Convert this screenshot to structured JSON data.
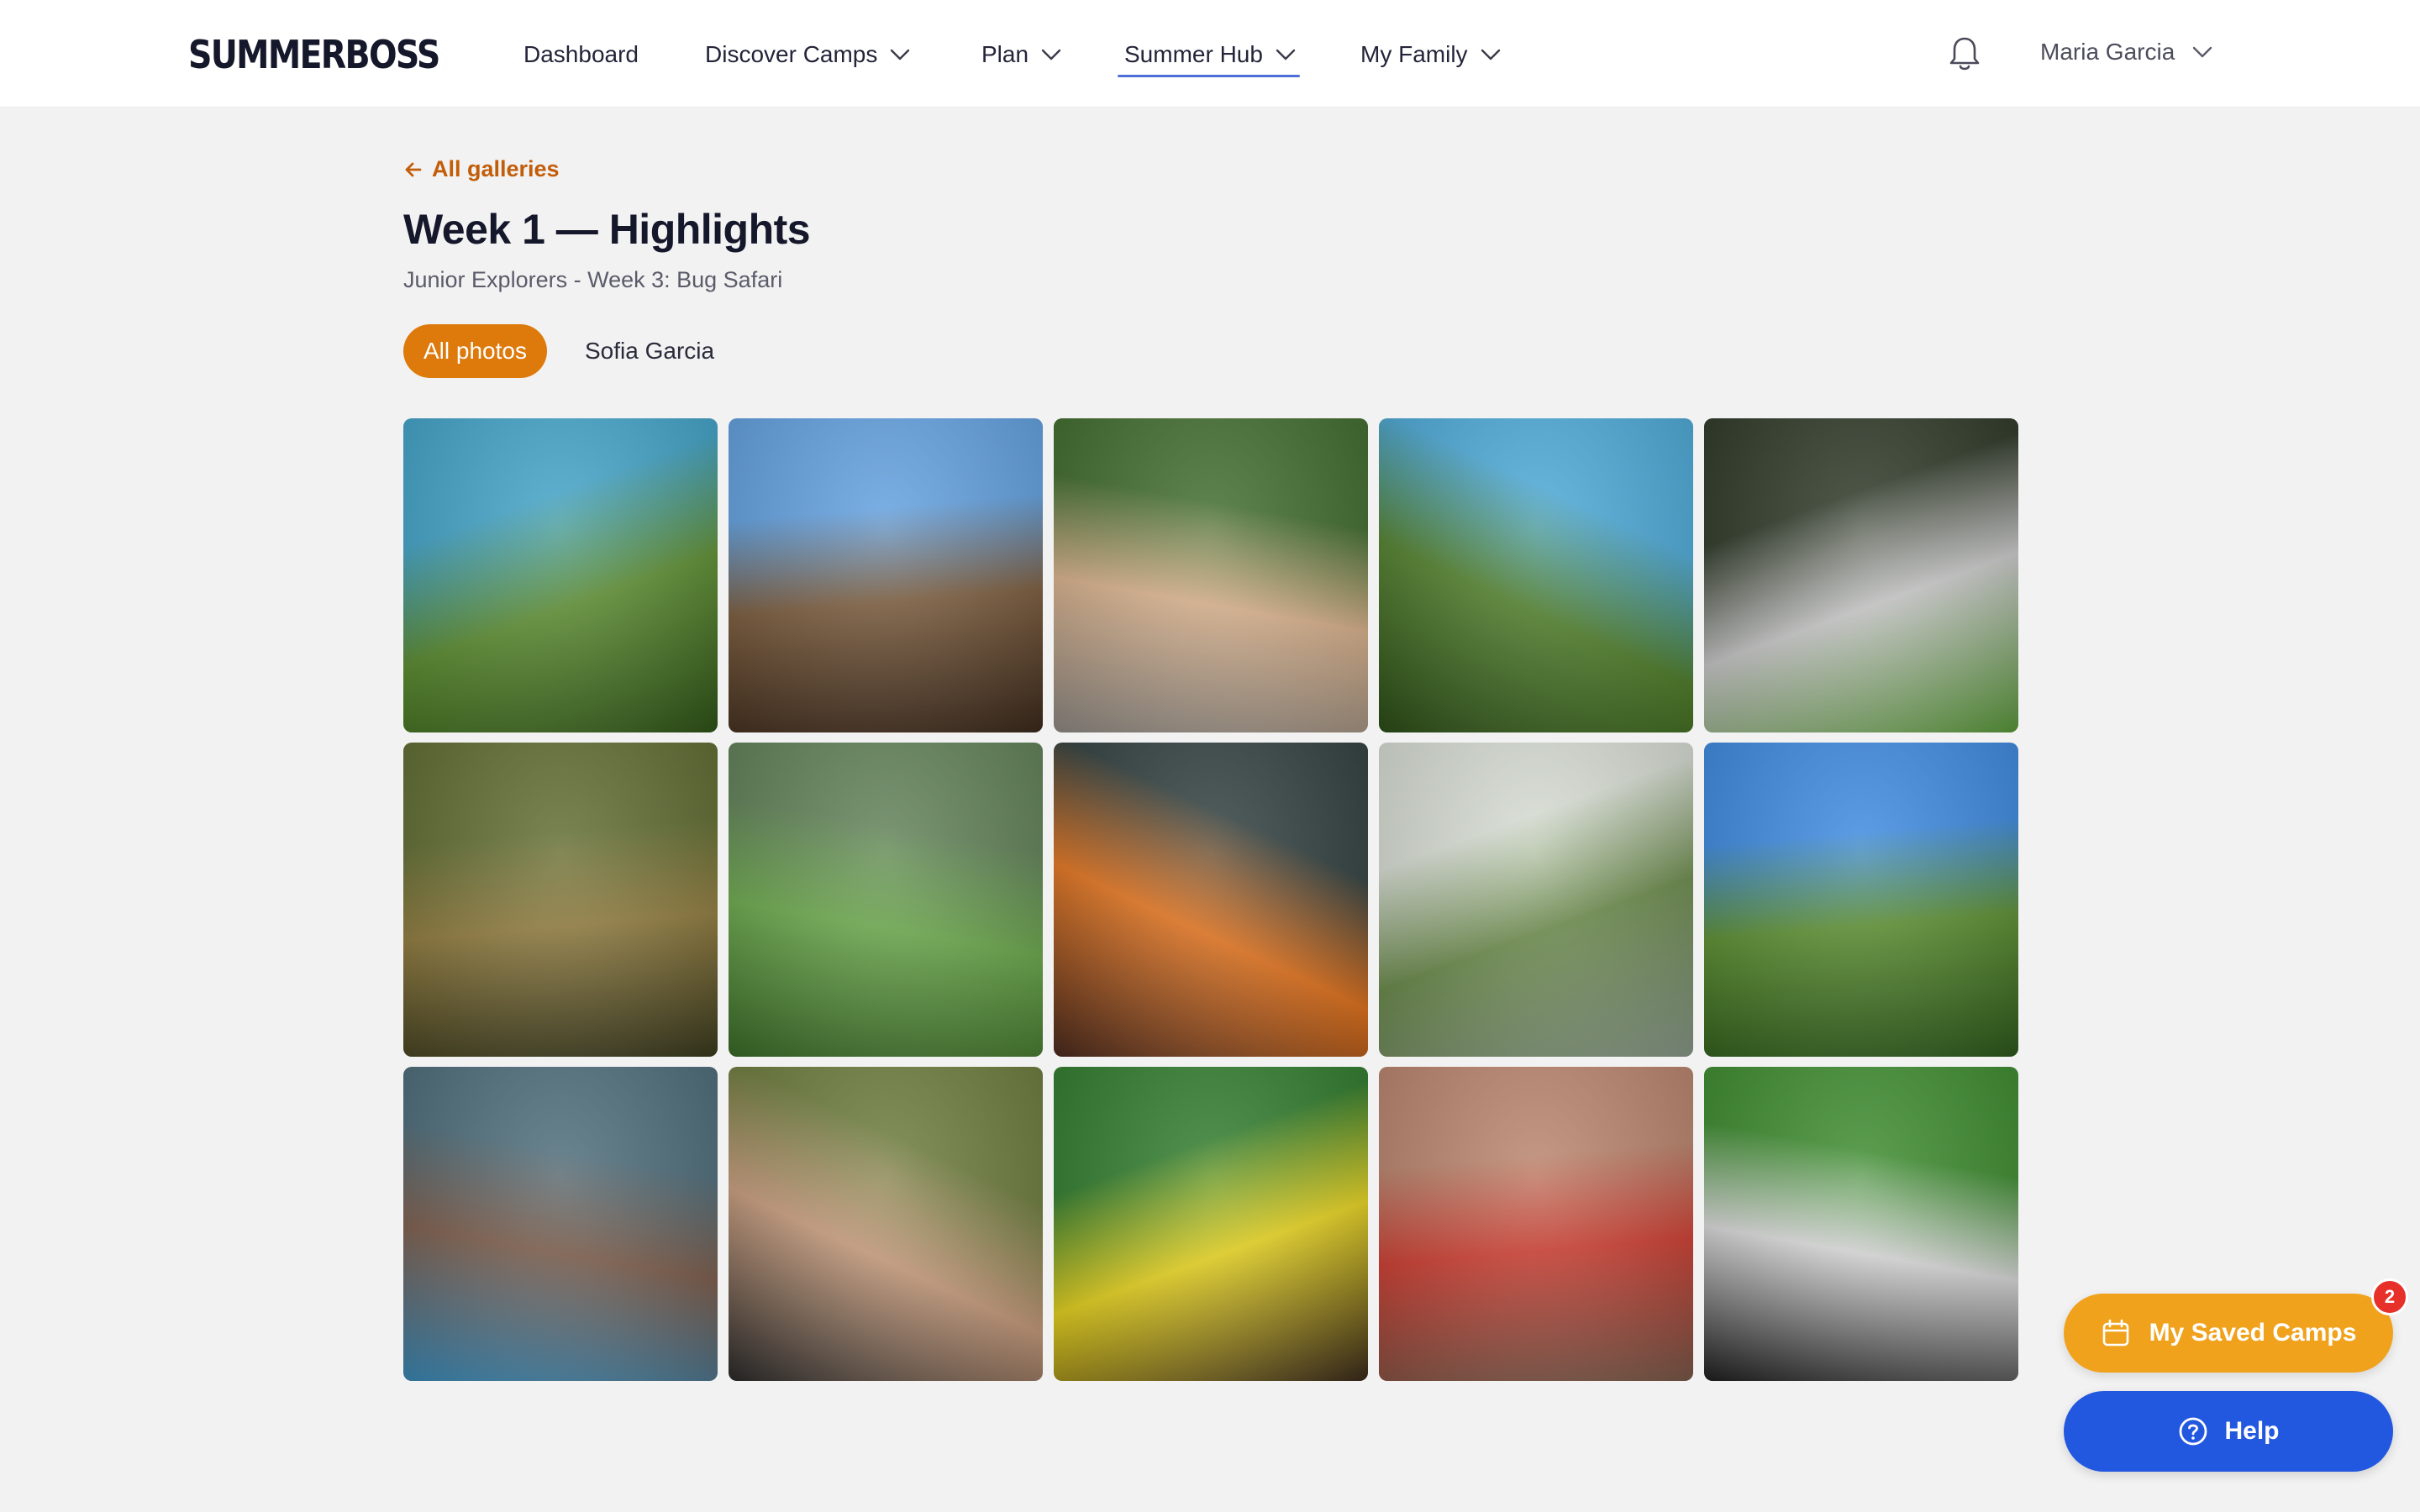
{
  "brand": {
    "logo": "SUMMERBOSS"
  },
  "nav": {
    "items": [
      {
        "label": "Dashboard",
        "has_dropdown": false,
        "active": false
      },
      {
        "label": "Discover Camps",
        "has_dropdown": true,
        "active": false
      },
      {
        "label": "Plan",
        "has_dropdown": true,
        "active": false
      },
      {
        "label": "Summer Hub",
        "has_dropdown": true,
        "active": true
      },
      {
        "label": "My Family",
        "has_dropdown": true,
        "active": false
      }
    ],
    "notifications_icon": "bell-icon",
    "user_name": "Maria Garcia"
  },
  "gallery": {
    "back_label": "All galleries",
    "title": "Week 1 — Highlights",
    "subtitle": "Junior Explorers - Week 3: Bug Safari",
    "filters": [
      {
        "label": "All photos",
        "active": true
      },
      {
        "label": "Sofia Garcia",
        "active": false
      }
    ],
    "photos": [
      {
        "colors": [
          "#3fa2c8",
          "#5b8d2f",
          "#2f5418"
        ]
      },
      {
        "colors": [
          "#5f9fe0",
          "#7a5a3a",
          "#3c2a1c"
        ]
      },
      {
        "colors": [
          "#3d6a2a",
          "#d8b08a",
          "#8f8a84"
        ]
      },
      {
        "colors": [
          "#4aa8d8",
          "#4f7f2a",
          "#2c4d18"
        ]
      },
      {
        "colors": [
          "#2b3524",
          "#c8c8c8",
          "#5a9a3a"
        ]
      },
      {
        "colors": [
          "#5d6a2e",
          "#8f7a3c",
          "#3a3a1e"
        ]
      },
      {
        "colors": [
          "#5e7f55",
          "#6aa84a",
          "#3a6a28"
        ]
      },
      {
        "colors": [
          "#2e3d3c",
          "#e2721c",
          "#4a2a1e"
        ]
      },
      {
        "colors": [
          "#d6dcd2",
          "#6a8a4a",
          "#8a9a8a"
        ]
      },
      {
        "colors": [
          "#3a88e0",
          "#5a8e2e",
          "#2e5a1c"
        ]
      },
      {
        "colors": [
          "#4a6a78",
          "#7a5a48",
          "#3a8ab8"
        ]
      },
      {
        "colors": [
          "#6a7a3a",
          "#c69a7a",
          "#2a2a2a"
        ]
      },
      {
        "colors": [
          "#2d7a2a",
          "#e6d21c",
          "#3a2a1c"
        ]
      },
      {
        "colors": [
          "#b8826a",
          "#cc3a2e",
          "#7a5a4a"
        ]
      },
      {
        "colors": [
          "#3a8a2c",
          "#d8d8d8",
          "#1e1e1e"
        ]
      }
    ]
  },
  "saved_camps": {
    "label": "My Saved Camps",
    "count": "2"
  },
  "help": {
    "label": "Help"
  },
  "colors": {
    "accent_orange": "#dd7a0b",
    "saved_button": "#f0a21c",
    "help_button": "#2258e0",
    "badge": "#e8302a",
    "active_underline": "#4f6fd8"
  }
}
